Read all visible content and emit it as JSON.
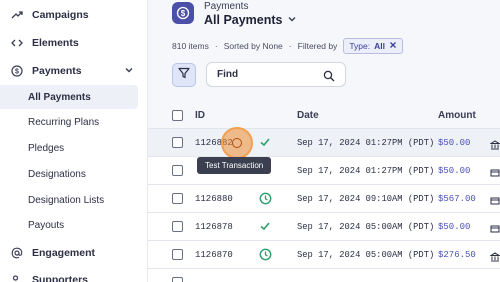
{
  "sidebar": {
    "items": [
      {
        "label": "Campaigns",
        "icon": "trend-icon"
      },
      {
        "label": "Elements",
        "icon": "code-icon"
      },
      {
        "label": "Payments",
        "icon": "dollar-circle-icon"
      },
      {
        "label": "Engagement",
        "icon": "at-icon"
      },
      {
        "label": "Supporters",
        "icon": "users-icon"
      }
    ],
    "payments_sub": [
      {
        "label": "All Payments",
        "active": true
      },
      {
        "label": "Recurring Plans"
      },
      {
        "label": "Pledges"
      },
      {
        "label": "Designations"
      },
      {
        "label": "Designation Lists"
      },
      {
        "label": "Payouts"
      }
    ]
  },
  "header": {
    "breadcrumb": "Payments",
    "title": "All Payments"
  },
  "meta": {
    "count": "810 items",
    "sorted": "Sorted by None",
    "filtered": "Filtered by",
    "chip_key": "Type:",
    "chip_val": "All"
  },
  "search": {
    "placeholder": "Find"
  },
  "table": {
    "columns": {
      "id": "ID",
      "date": "Date",
      "amount": "Amount"
    },
    "rows": [
      {
        "id": "1126882",
        "date": "Sep 17, 2024 01:27PM (PDT)",
        "amount": "$50.00",
        "status": "check"
      },
      {
        "id": "",
        "date": "Sep 17, 2024 01:27PM (PDT)",
        "amount": "$50.00",
        "status": "none"
      },
      {
        "id": "1126880",
        "date": "Sep 17, 2024 09:10AM (PDT)",
        "amount": "$567.00",
        "status": "clock"
      },
      {
        "id": "1126878",
        "date": "Sep 17, 2024 05:00AM (PDT)",
        "amount": "$50.00",
        "status": "check"
      },
      {
        "id": "1126870",
        "date": "Sep 17, 2024 05:00AM (PDT)",
        "amount": "$276.50",
        "status": "clock"
      }
    ]
  },
  "tooltip": "Test Transaction",
  "colors": {
    "accent": "#4b4fa8",
    "success": "#2e9e6a",
    "amount": "#4b52b5"
  }
}
